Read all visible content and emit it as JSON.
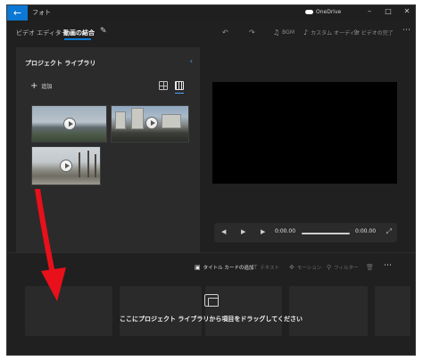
{
  "window": {
    "app_title": "フォト",
    "onedrive_label": "OneDrive"
  },
  "toolbar": {
    "breadcrumb_root": "ビデオ エディター",
    "breadcrumb_current": "動画の結合",
    "tools": [
      {
        "label": "BGM",
        "icon": "music-note-icon"
      },
      {
        "label": "カスタム オーディオ",
        "icon": "audio-icon"
      },
      {
        "label": "ビデオの完了",
        "icon": "export-icon"
      }
    ]
  },
  "library": {
    "title": "プロジェクト ライブラリ",
    "add_label": "追加"
  },
  "player": {
    "current_time": "0:00.00",
    "total_time": "0:00.00",
    "progress": 0
  },
  "storyboard": {
    "tools": [
      {
        "label": "タイトル カードの追加",
        "enabled": true
      },
      {
        "label": "テキスト",
        "enabled": false
      },
      {
        "label": "モーション",
        "enabled": false
      },
      {
        "label": "フィルター",
        "enabled": false
      }
    ],
    "drop_hint": "ここにプロジェクト ライブラリから項目をドラッグしてください"
  },
  "colors": {
    "accent": "#0a78d4",
    "background": "#202020",
    "panel": "#2b2b2b",
    "annotation_arrow": "#e8101a"
  }
}
